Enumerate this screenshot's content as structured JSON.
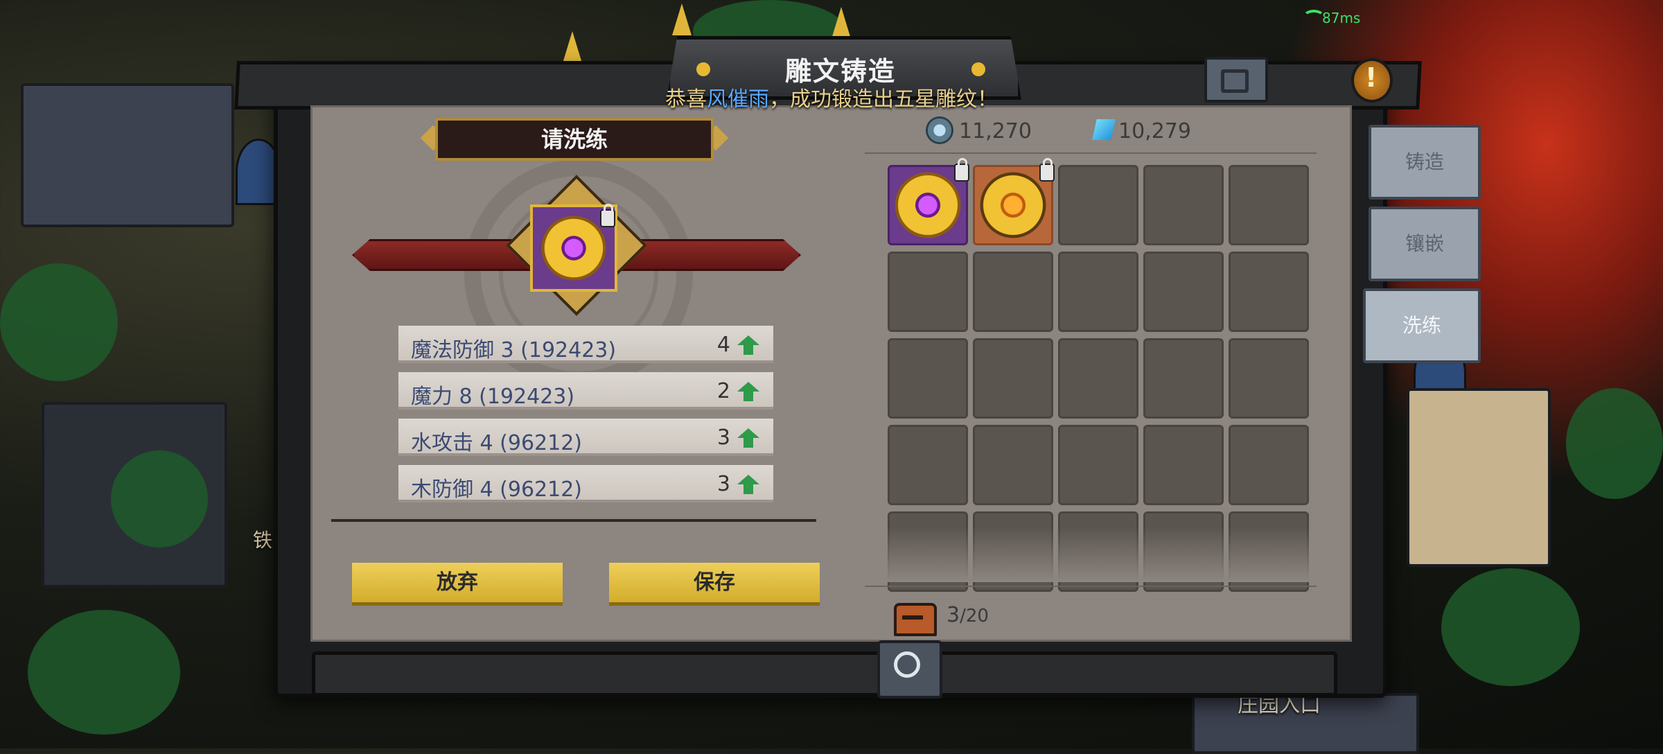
{
  "status_bar": {
    "ping": "87ms"
  },
  "window": {
    "title": "雕文铸造"
  },
  "broadcast": {
    "prefix": "恭喜",
    "player": "风催雨",
    "suffix": "，成功锻造出五星雕纹！"
  },
  "refine_panel": {
    "header": "请洗练",
    "stats": [
      {
        "label": "魔法防御 3 (192423)",
        "value": "4"
      },
      {
        "label": "魔力 8 (192423)",
        "value": "2"
      },
      {
        "label": "水攻击 4 (96212)",
        "value": "3"
      },
      {
        "label": "木防御 4 (96212)",
        "value": "3"
      }
    ],
    "abandon_label": "放弃",
    "save_label": "保存"
  },
  "currency": {
    "coins": "11,270",
    "gems": "10,279"
  },
  "inventory": {
    "capacity_used": "3",
    "capacity_total": "/20",
    "items": [
      {
        "type": "purple-rune",
        "locked": true
      },
      {
        "type": "orange-rune",
        "locked": true
      }
    ]
  },
  "side_tabs": [
    {
      "label": "铸造",
      "active": false
    },
    {
      "label": "镶嵌",
      "active": false
    },
    {
      "label": "洗练",
      "active": true
    }
  ],
  "map_labels": {
    "left": "铁",
    "right": "庄园入口"
  },
  "colors": {
    "accent_gold": "#e8c24a",
    "player_name": "#5aa7ff",
    "stat_up": "#2f9a4a"
  }
}
